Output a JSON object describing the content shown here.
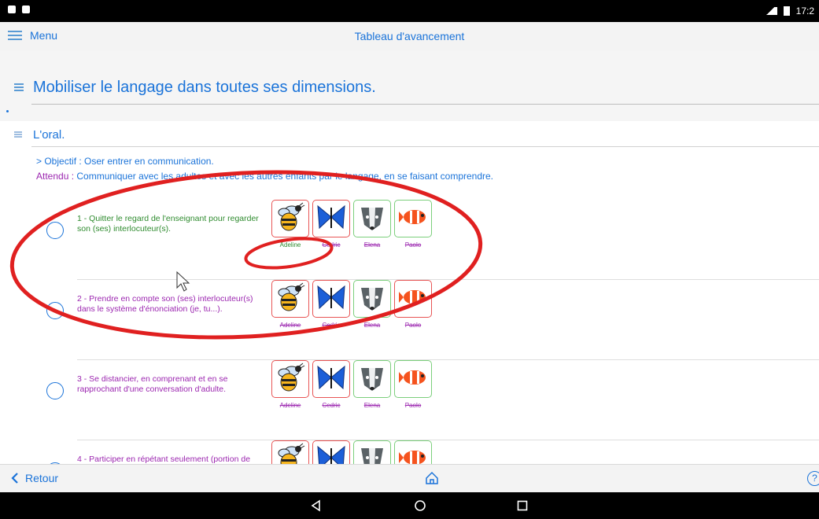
{
  "status": {
    "time": "17:2"
  },
  "header": {
    "menu_label": "Menu",
    "title": "Tableau d'avancement"
  },
  "section": {
    "title": "Mobiliser le langage dans toutes ses dimensions."
  },
  "subsection": {
    "title": "L'oral."
  },
  "objective": {
    "prefix": "> Objectif : ",
    "text": "Oser entrer en communication."
  },
  "expected": {
    "label": "Attendu : ",
    "text": "Communiquer avec les adultes et avec les autres enfants par le langage, en se faisant comprendre."
  },
  "items": [
    {
      "text": "1 - Quitter le regard de l'enseignant pour regarder son (ses) interlocuteur(s).",
      "text_color": "#2e8b2e"
    },
    {
      "text": "2 - Prendre en compte son (ses) interlocuteur(s) dans le système d'énonciation (je, tu...).",
      "text_color": "#9c27b0"
    },
    {
      "text": "3 - Se distancier, en comprenant et en se rapprochant d'une conversation d'adulte.",
      "text_color": "#9c27b0"
    },
    {
      "text": "4 - Participer en répétant seulement (portion de",
      "text_color": "#9c27b0"
    }
  ],
  "students": [
    {
      "name": "Adeline",
      "icon": "bee-icon"
    },
    {
      "name": "Cedric",
      "icon": "butterfly-icon"
    },
    {
      "name": "Elena",
      "icon": "badger-icon"
    },
    {
      "name": "Paolo",
      "icon": "fish-icon"
    }
  ],
  "footer": {
    "back_label": "Retour",
    "help_label": "?"
  },
  "colors": {
    "accent": "#1a73d9",
    "purple": "#9c27b0",
    "green": "#2e8b2e",
    "red_border": "#e85555",
    "green_border": "#7ccf7c",
    "annotation": "#e02020"
  }
}
